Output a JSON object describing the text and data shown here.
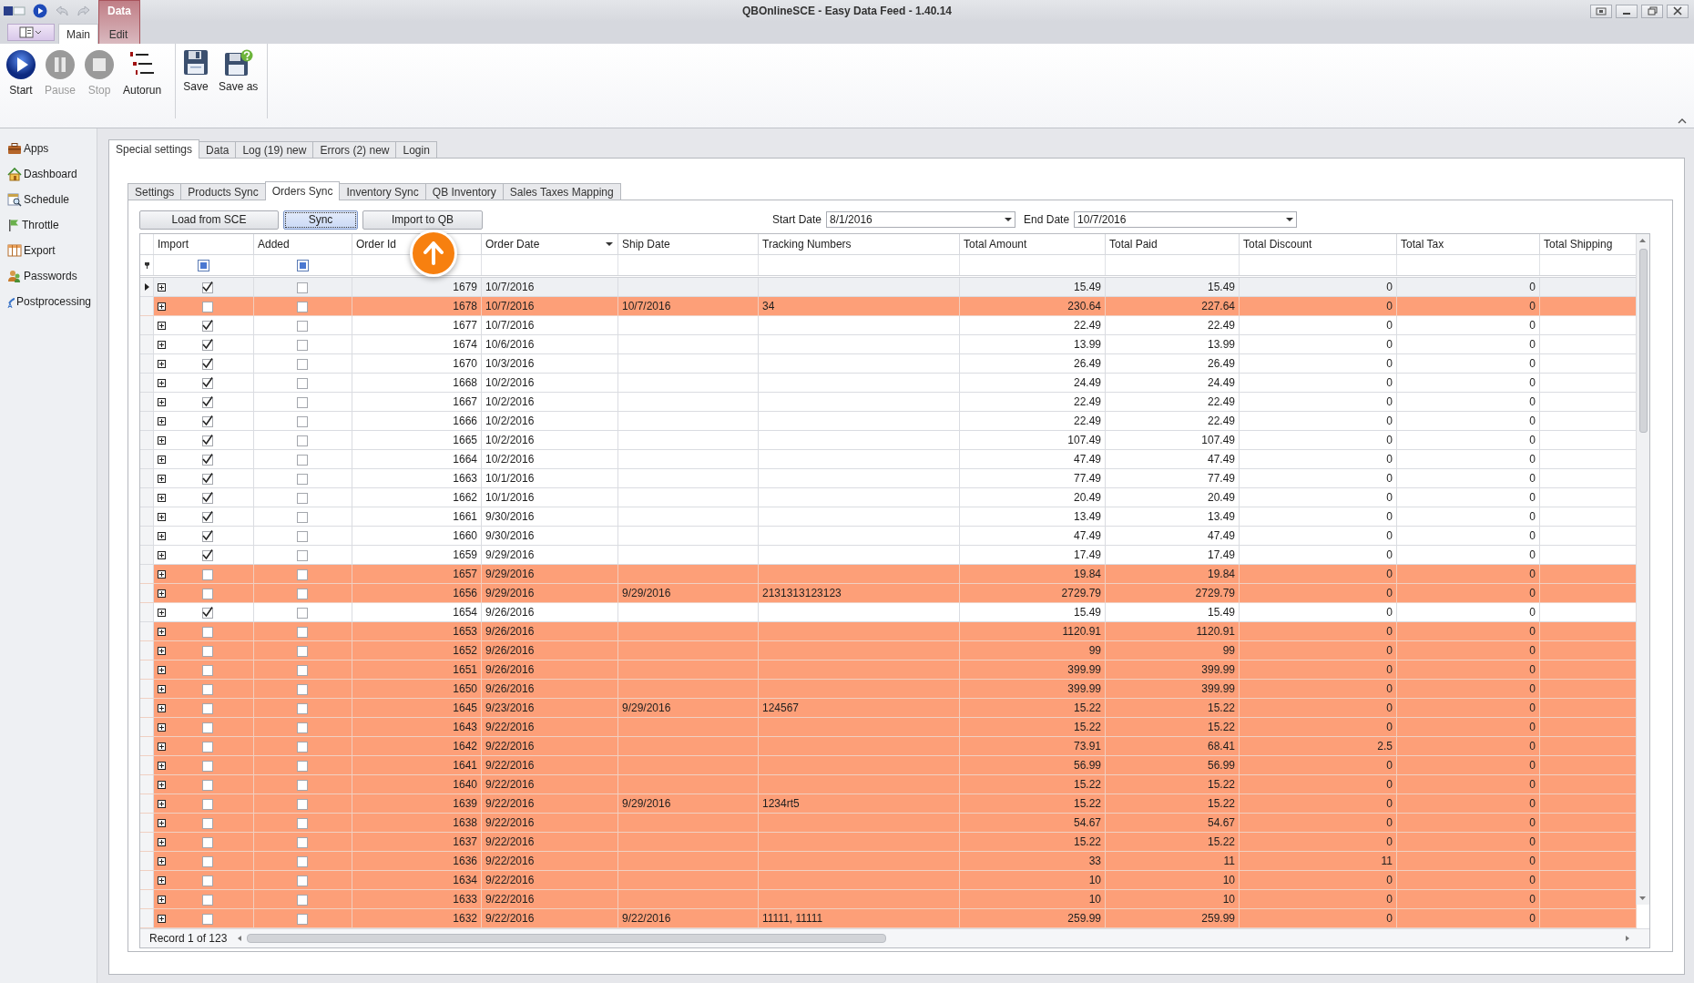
{
  "window": {
    "title": "QBOnlineSCE - Easy Data Feed - 1.40.14"
  },
  "ribbon": {
    "context_tab": "Data",
    "tabs": [
      {
        "label": "Main",
        "selected": true
      },
      {
        "label": "Edit",
        "selected": false
      }
    ],
    "groups": [
      {
        "buttons": [
          {
            "label": "Start",
            "disabled": false
          },
          {
            "label": "Pause",
            "disabled": true
          },
          {
            "label": "Stop",
            "disabled": true
          },
          {
            "label": "Autorun",
            "disabled": false
          }
        ]
      },
      {
        "buttons": [
          {
            "label": "Save",
            "disabled": false
          },
          {
            "label": "Save as",
            "disabled": false
          }
        ]
      }
    ]
  },
  "sidebar": {
    "items": [
      {
        "label": "Apps"
      },
      {
        "label": "Dashboard"
      },
      {
        "label": "Schedule"
      },
      {
        "label": "Throttle"
      },
      {
        "label": "Export"
      },
      {
        "label": "Passwords"
      },
      {
        "label": "Postprocessing"
      }
    ]
  },
  "tabs": [
    {
      "label": "Special settings",
      "selected": true
    },
    {
      "label": "Data",
      "selected": false
    },
    {
      "label": "Log (19) new",
      "selected": false
    },
    {
      "label": "Errors (2) new",
      "selected": false
    },
    {
      "label": "Login",
      "selected": false
    }
  ],
  "subtabs": [
    {
      "label": "Settings",
      "selected": false
    },
    {
      "label": "Products Sync",
      "selected": false
    },
    {
      "label": "Orders Sync",
      "selected": true
    },
    {
      "label": "Inventory Sync",
      "selected": false
    },
    {
      "label": "QB Inventory",
      "selected": false
    },
    {
      "label": "Sales Taxes Mapping",
      "selected": false
    }
  ],
  "buttons": [
    {
      "label": "Load from SCE",
      "focused": false
    },
    {
      "label": "Sync",
      "focused": true
    },
    {
      "label": "Import to QB",
      "focused": false
    }
  ],
  "date_range": {
    "start_label": "Start Date",
    "start": "8/1/2016",
    "end_label": "End Date",
    "end": "10/7/2016"
  },
  "grid": {
    "columns": [
      {
        "label": "Import",
        "dropdown": false
      },
      {
        "label": "Added",
        "dropdown": false
      },
      {
        "label": "Order Id",
        "dropdown": false
      },
      {
        "label": "Order Date",
        "dropdown": true
      },
      {
        "label": "Ship Date",
        "dropdown": false
      },
      {
        "label": "Tracking Numbers",
        "dropdown": false
      },
      {
        "label": "Total Amount",
        "dropdown": false
      },
      {
        "label": "Total Paid",
        "dropdown": false
      },
      {
        "label": "Total Discount",
        "dropdown": false
      },
      {
        "label": "Total Tax",
        "dropdown": false
      },
      {
        "label": "Total Shipping",
        "dropdown": false
      }
    ],
    "rows": [
      {
        "selected": true,
        "highlighted": false,
        "import": true,
        "added": false,
        "order_id": "1679",
        "order_date": "10/7/2016",
        "total_amount": "15.49",
        "total_paid": "15.49",
        "total_discount": "0",
        "total_tax": "0"
      },
      {
        "selected": false,
        "highlighted": true,
        "import": false,
        "added": false,
        "order_id": "1678",
        "order_date": "10/7/2016",
        "ship_date": "10/7/2016",
        "tracking": "34",
        "total_amount": "230.64",
        "total_paid": "227.64",
        "total_discount": "0",
        "total_tax": "0"
      },
      {
        "selected": false,
        "highlighted": false,
        "import": true,
        "added": false,
        "order_id": "1677",
        "order_date": "10/7/2016",
        "total_amount": "22.49",
        "total_paid": "22.49",
        "total_discount": "0",
        "total_tax": "0"
      },
      {
        "selected": false,
        "highlighted": false,
        "import": true,
        "added": false,
        "order_id": "1674",
        "order_date": "10/6/2016",
        "total_amount": "13.99",
        "total_paid": "13.99",
        "total_discount": "0",
        "total_tax": "0"
      },
      {
        "selected": false,
        "highlighted": false,
        "import": true,
        "added": false,
        "order_id": "1670",
        "order_date": "10/3/2016",
        "total_amount": "26.49",
        "total_paid": "26.49",
        "total_discount": "0",
        "total_tax": "0"
      },
      {
        "selected": false,
        "highlighted": false,
        "import": true,
        "added": false,
        "order_id": "1668",
        "order_date": "10/2/2016",
        "total_amount": "24.49",
        "total_paid": "24.49",
        "total_discount": "0",
        "total_tax": "0"
      },
      {
        "selected": false,
        "highlighted": false,
        "import": true,
        "added": false,
        "order_id": "1667",
        "order_date": "10/2/2016",
        "total_amount": "22.49",
        "total_paid": "22.49",
        "total_discount": "0",
        "total_tax": "0"
      },
      {
        "selected": false,
        "highlighted": false,
        "import": true,
        "added": false,
        "order_id": "1666",
        "order_date": "10/2/2016",
        "total_amount": "22.49",
        "total_paid": "22.49",
        "total_discount": "0",
        "total_tax": "0"
      },
      {
        "selected": false,
        "highlighted": false,
        "import": true,
        "added": false,
        "order_id": "1665",
        "order_date": "10/2/2016",
        "total_amount": "107.49",
        "total_paid": "107.49",
        "total_discount": "0",
        "total_tax": "0"
      },
      {
        "selected": false,
        "highlighted": false,
        "import": true,
        "added": false,
        "order_id": "1664",
        "order_date": "10/2/2016",
        "total_amount": "47.49",
        "total_paid": "47.49",
        "total_discount": "0",
        "total_tax": "0"
      },
      {
        "selected": false,
        "highlighted": false,
        "import": true,
        "added": false,
        "order_id": "1663",
        "order_date": "10/1/2016",
        "total_amount": "77.49",
        "total_paid": "77.49",
        "total_discount": "0",
        "total_tax": "0"
      },
      {
        "selected": false,
        "highlighted": false,
        "import": true,
        "added": false,
        "order_id": "1662",
        "order_date": "10/1/2016",
        "total_amount": "20.49",
        "total_paid": "20.49",
        "total_discount": "0",
        "total_tax": "0"
      },
      {
        "selected": false,
        "highlighted": false,
        "import": true,
        "added": false,
        "order_id": "1661",
        "order_date": "9/30/2016",
        "total_amount": "13.49",
        "total_paid": "13.49",
        "total_discount": "0",
        "total_tax": "0"
      },
      {
        "selected": false,
        "highlighted": false,
        "import": true,
        "added": false,
        "order_id": "1660",
        "order_date": "9/30/2016",
        "total_amount": "47.49",
        "total_paid": "47.49",
        "total_discount": "0",
        "total_tax": "0"
      },
      {
        "selected": false,
        "highlighted": false,
        "import": true,
        "added": false,
        "order_id": "1659",
        "order_date": "9/29/2016",
        "total_amount": "17.49",
        "total_paid": "17.49",
        "total_discount": "0",
        "total_tax": "0"
      },
      {
        "selected": false,
        "highlighted": true,
        "import": false,
        "added": false,
        "order_id": "1657",
        "order_date": "9/29/2016",
        "total_amount": "19.84",
        "total_paid": "19.84",
        "total_discount": "0",
        "total_tax": "0"
      },
      {
        "selected": false,
        "highlighted": true,
        "import": false,
        "added": false,
        "order_id": "1656",
        "order_date": "9/29/2016",
        "ship_date": "9/29/2016",
        "tracking": "2131313123123",
        "total_amount": "2729.79",
        "total_paid": "2729.79",
        "total_discount": "0",
        "total_tax": "0"
      },
      {
        "selected": false,
        "highlighted": false,
        "import": true,
        "added": false,
        "order_id": "1654",
        "order_date": "9/26/2016",
        "total_amount": "15.49",
        "total_paid": "15.49",
        "total_discount": "0",
        "total_tax": "0"
      },
      {
        "selected": false,
        "highlighted": true,
        "import": false,
        "added": false,
        "order_id": "1653",
        "order_date": "9/26/2016",
        "total_amount": "1120.91",
        "total_paid": "1120.91",
        "total_discount": "0",
        "total_tax": "0"
      },
      {
        "selected": false,
        "highlighted": true,
        "import": false,
        "added": false,
        "order_id": "1652",
        "order_date": "9/26/2016",
        "total_amount": "99",
        "total_paid": "99",
        "total_discount": "0",
        "total_tax": "0"
      },
      {
        "selected": false,
        "highlighted": true,
        "import": false,
        "added": false,
        "order_id": "1651",
        "order_date": "9/26/2016",
        "total_amount": "399.99",
        "total_paid": "399.99",
        "total_discount": "0",
        "total_tax": "0"
      },
      {
        "selected": false,
        "highlighted": true,
        "import": false,
        "added": false,
        "order_id": "1650",
        "order_date": "9/26/2016",
        "total_amount": "399.99",
        "total_paid": "399.99",
        "total_discount": "0",
        "total_tax": "0"
      },
      {
        "selected": false,
        "highlighted": true,
        "import": false,
        "added": false,
        "order_id": "1645",
        "order_date": "9/23/2016",
        "ship_date": "9/29/2016",
        "tracking": "124567",
        "total_amount": "15.22",
        "total_paid": "15.22",
        "total_discount": "0",
        "total_tax": "0"
      },
      {
        "selected": false,
        "highlighted": true,
        "import": false,
        "added": false,
        "order_id": "1643",
        "order_date": "9/22/2016",
        "total_amount": "15.22",
        "total_paid": "15.22",
        "total_discount": "0",
        "total_tax": "0"
      },
      {
        "selected": false,
        "highlighted": true,
        "import": false,
        "added": false,
        "order_id": "1642",
        "order_date": "9/22/2016",
        "total_amount": "73.91",
        "total_paid": "68.41",
        "total_discount": "2.5",
        "total_tax": "0"
      },
      {
        "selected": false,
        "highlighted": true,
        "import": false,
        "added": false,
        "order_id": "1641",
        "order_date": "9/22/2016",
        "total_amount": "56.99",
        "total_paid": "56.99",
        "total_discount": "0",
        "total_tax": "0"
      },
      {
        "selected": false,
        "highlighted": true,
        "import": false,
        "added": false,
        "order_id": "1640",
        "order_date": "9/22/2016",
        "total_amount": "15.22",
        "total_paid": "15.22",
        "total_discount": "0",
        "total_tax": "0"
      },
      {
        "selected": false,
        "highlighted": true,
        "import": false,
        "added": false,
        "order_id": "1639",
        "order_date": "9/22/2016",
        "ship_date": "9/29/2016",
        "tracking": "1234rt5",
        "total_amount": "15.22",
        "total_paid": "15.22",
        "total_discount": "0",
        "total_tax": "0"
      },
      {
        "selected": false,
        "highlighted": true,
        "import": false,
        "added": false,
        "order_id": "1638",
        "order_date": "9/22/2016",
        "total_amount": "54.67",
        "total_paid": "54.67",
        "total_discount": "0",
        "total_tax": "0"
      },
      {
        "selected": false,
        "highlighted": true,
        "import": false,
        "added": false,
        "order_id": "1637",
        "order_date": "9/22/2016",
        "total_amount": "15.22",
        "total_paid": "15.22",
        "total_discount": "0",
        "total_tax": "0"
      },
      {
        "selected": false,
        "highlighted": true,
        "import": false,
        "added": false,
        "order_id": "1636",
        "order_date": "9/22/2016",
        "total_amount": "33",
        "total_paid": "11",
        "total_discount": "11",
        "total_tax": "0"
      },
      {
        "selected": false,
        "highlighted": true,
        "import": false,
        "added": false,
        "order_id": "1634",
        "order_date": "9/22/2016",
        "total_amount": "10",
        "total_paid": "10",
        "total_discount": "0",
        "total_tax": "0"
      },
      {
        "selected": false,
        "highlighted": true,
        "import": false,
        "added": false,
        "order_id": "1633",
        "order_date": "9/22/2016",
        "total_amount": "10",
        "total_paid": "10",
        "total_discount": "0",
        "total_tax": "0"
      },
      {
        "selected": false,
        "highlighted": true,
        "import": false,
        "added": false,
        "order_id": "1632",
        "order_date": "9/22/2016",
        "ship_date": "9/22/2016",
        "tracking": "11111, 11111",
        "total_amount": "259.99",
        "total_paid": "259.99",
        "total_discount": "0",
        "total_tax": "0"
      }
    ],
    "record_info": "Record 1 of 123"
  }
}
